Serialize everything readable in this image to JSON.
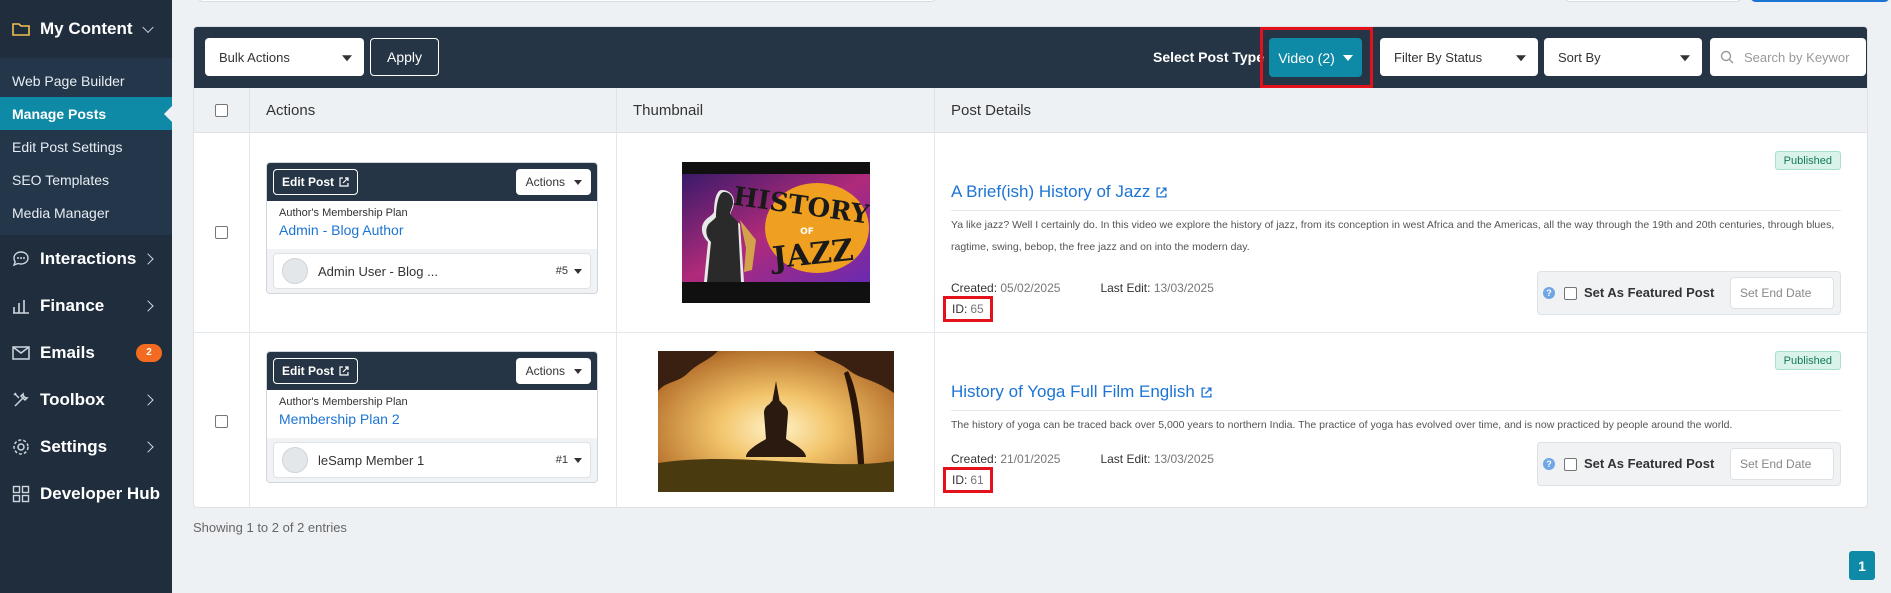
{
  "sidebar": {
    "my_content": "My Content",
    "sub_items": [
      "Web Page Builder",
      "Manage Posts",
      "Edit Post Settings",
      "SEO Templates",
      "Media Manager"
    ],
    "interactions": "Interactions",
    "finance": "Finance",
    "emails": "Emails",
    "emails_badge": "2",
    "toolbox": "Toolbox",
    "settings": "Settings",
    "developer_hub": "Developer Hub"
  },
  "toolbar": {
    "bulk_actions": "Bulk Actions",
    "apply": "Apply",
    "select_post_type_label": "Select Post Type",
    "post_type": "Video (2)",
    "filter_status": "Filter By Status",
    "sort_by": "Sort By",
    "search_placeholder": "Search by Keywor"
  },
  "table": {
    "headers": [
      "Actions",
      "Thumbnail",
      "Post Details"
    ],
    "rows": [
      {
        "edit_label": "Edit Post",
        "actions_label": "Actions",
        "plan_label": "Author's Membership Plan",
        "plan_value": "Admin - Blog Author",
        "user": "Admin User - Blog ...",
        "user_num": "#5",
        "status": "Published",
        "title": "A Brief(ish) History of Jazz",
        "description": "Ya like jazz? Well I certainly do. In this video we explore the history of jazz, from its conception in west Africa and the Americas, all the way through the 19th and 20th centuries, through blues, ragtime, swing, bebop, the free jazz and on into the modern day.",
        "created_label": "Created:",
        "created": "05/02/2025",
        "last_edit_label": "Last Edit:",
        "last_edit": "13/03/2025",
        "id_label": "ID:",
        "id": "65",
        "featured_label": "Set As Featured Post",
        "end_date_placeholder": "Set End Date",
        "thumb_text_1": "HISTORY",
        "thumb_text_2": "OF",
        "thumb_text_3": "JAZZ"
      },
      {
        "edit_label": "Edit Post",
        "actions_label": "Actions",
        "plan_label": "Author's Membership Plan",
        "plan_value": "Membership Plan 2",
        "user": "leSamp Member 1",
        "user_num": "#1",
        "status": "Published",
        "title": "History of Yoga Full Film English",
        "description": "The history of yoga can be traced back over 5,000 years to northern India. The practice of yoga has evolved over time, and is now practiced by people around the world.",
        "created_label": "Created:",
        "created": "21/01/2025",
        "last_edit_label": "Last Edit:",
        "last_edit": "13/03/2025",
        "id_label": "ID:",
        "id": "61",
        "featured_label": "Set As Featured Post",
        "end_date_placeholder": "Set End Date"
      }
    ]
  },
  "footer": {
    "showing": "Showing 1 to 2 of 2 entries",
    "page": "1"
  }
}
